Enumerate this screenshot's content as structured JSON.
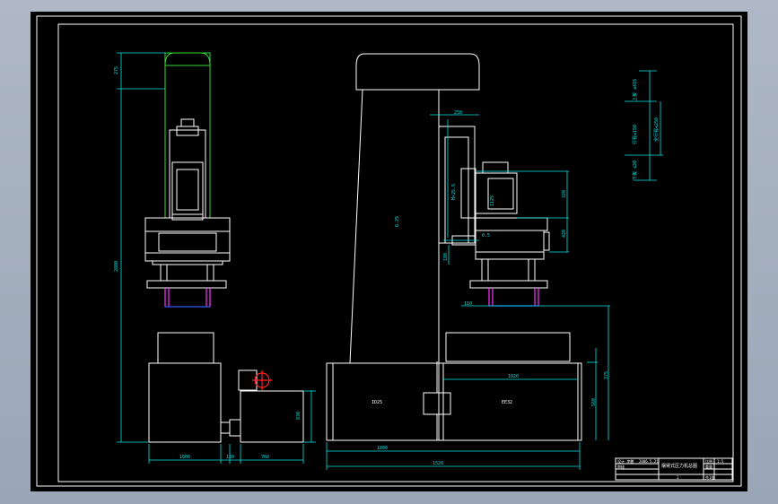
{
  "drawing": {
    "dims_left": {
      "top": "275",
      "height": "2800",
      "base_w": "1800",
      "gap": "150",
      "unit_w": "760",
      "unit_h": "830"
    },
    "dims_right": {
      "top": "250",
      "c1": "1125",
      "c2": "320",
      "c3": "420",
      "c4": "180",
      "c5": "0.5",
      "col": "G.25",
      "spring": "M×25.5",
      "h1": "110",
      "h2": "375",
      "h3": "560",
      "w1": "1020",
      "w2": "1800",
      "w3": "1520",
      "box_l": "ID25",
      "box_r": "EE32"
    },
    "legend": {
      "a": "上板 ≤415",
      "b": "行程≤150",
      "c": "全行程≤250",
      "d": "下板 ≤20"
    }
  },
  "title_block": {
    "name": "摆臂式压力机总图",
    "scale": "1:5",
    "row1": "设计 李鹏",
    "row2": "2006.5.21",
    "row3": "审核",
    "row4": "比例",
    "row5": "重量",
    "sheet": "共1张",
    "num": "1"
  },
  "colors": {
    "line": "#ffffff",
    "dim": "#00e5e5",
    "green": "#33dd33",
    "blue": "#3355ff",
    "magenta": "#ff33ff",
    "red": "#ff2222"
  }
}
